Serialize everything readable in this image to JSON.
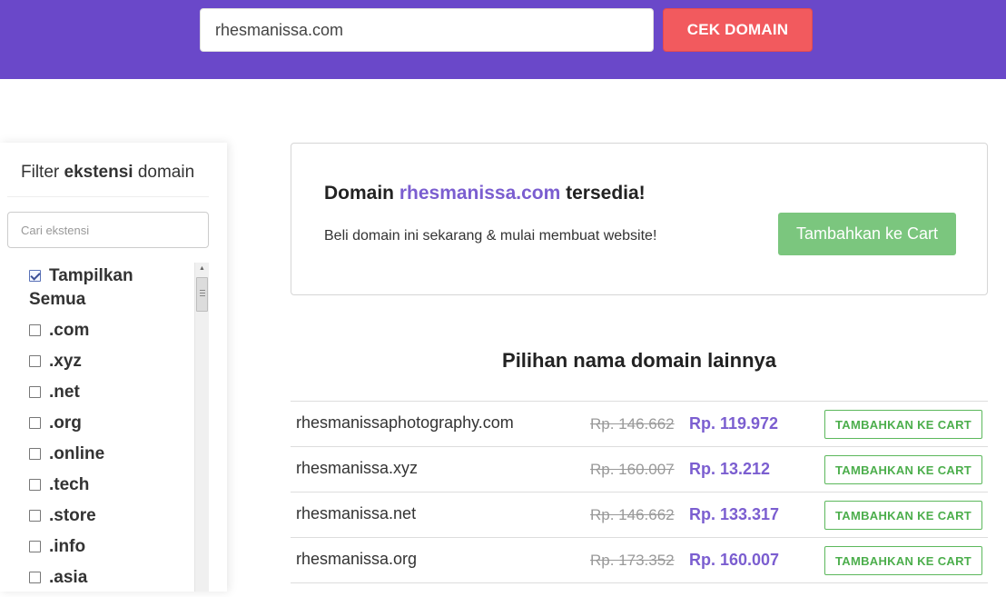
{
  "header": {
    "domain_input_value": "rhesmanissa.com",
    "cek_button_label": "CEK DOMAIN"
  },
  "sidebar": {
    "title_prefix": "Filter ",
    "title_bold": "ekstensi",
    "title_suffix": " domain",
    "search_placeholder": "Cari ekstensi",
    "items": [
      {
        "label": "Tampilkan Semua",
        "checked": true
      },
      {
        "label": ".com",
        "checked": false
      },
      {
        "label": ".xyz",
        "checked": false
      },
      {
        "label": ".net",
        "checked": false
      },
      {
        "label": ".org",
        "checked": false
      },
      {
        "label": ".online",
        "checked": false
      },
      {
        "label": ".tech",
        "checked": false
      },
      {
        "label": ".store",
        "checked": false
      },
      {
        "label": ".info",
        "checked": false
      },
      {
        "label": ".asia",
        "checked": false
      }
    ]
  },
  "result": {
    "title_prefix": "Domain ",
    "domain": "rhesmanissa.com",
    "title_suffix": " tersedia!",
    "subtitle": "Beli domain ini sekarang & mulai membuat website!",
    "add_cart_label": "Tambahkan ke Cart"
  },
  "alternatives": {
    "heading": "Pilihan nama domain lainnya",
    "button_label": "TAMBAHKAN KE CART",
    "rows": [
      {
        "name": "rhesmanissaphotography.com",
        "old_price": "Rp. 146.662",
        "new_price": "Rp. 119.972"
      },
      {
        "name": "rhesmanissa.xyz",
        "old_price": "Rp. 160.007",
        "new_price": "Rp. 13.212"
      },
      {
        "name": "rhesmanissa.net",
        "old_price": "Rp. 146.662",
        "new_price": "Rp. 133.317"
      },
      {
        "name": "rhesmanissa.org",
        "old_price": "Rp. 173.352",
        "new_price": "Rp. 160.007"
      }
    ]
  },
  "colors": {
    "header_bg": "#6a48c9",
    "cek_button": "#f25a5e",
    "accent_purple": "#7b5ed0",
    "green": "#7bc67e"
  }
}
